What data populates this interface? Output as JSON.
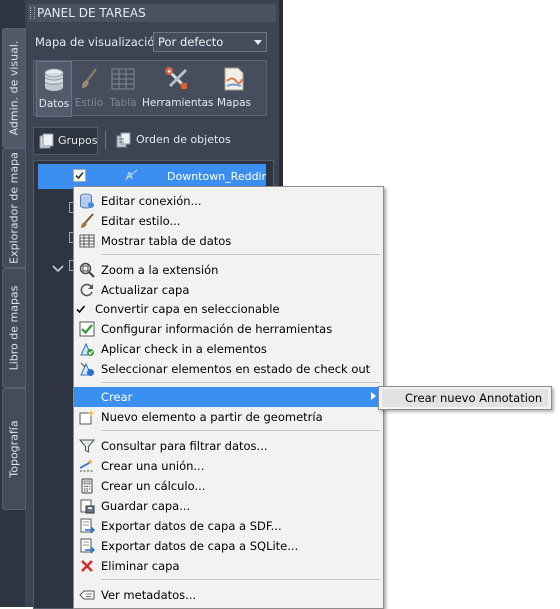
{
  "task_panel": {
    "title": "PANEL DE TAREAS",
    "vertical_tabs": [
      {
        "label": "Admin. de visual.",
        "active": true
      },
      {
        "label": "Explorador de mapa",
        "active": false
      },
      {
        "label": "Libro de mapas",
        "active": false
      },
      {
        "label": "Topografía",
        "active": false
      }
    ],
    "map_view_label": "Mapa de visualización:",
    "map_view_value": "Por defecto",
    "toolbar": [
      {
        "label": "Datos",
        "icon": "database-icon",
        "enabled": true
      },
      {
        "label": "Estilo",
        "icon": "brush-icon",
        "enabled": false
      },
      {
        "label": "Tabla",
        "icon": "table-icon",
        "enabled": false
      },
      {
        "label": "Herramientas",
        "icon": "tools-icon",
        "enabled": true
      },
      {
        "label": "Mapas",
        "icon": "map-icon",
        "enabled": true
      }
    ],
    "view_tabs": {
      "groups": "Grupos",
      "draw_order": "Orden de objetos"
    },
    "selected_layer": "Downtown_Reddir"
  },
  "context_menu": {
    "items": [
      {
        "label": "Editar conexión...",
        "icon": "connection-icon"
      },
      {
        "label": "Editar estilo...",
        "icon": "brush-icon"
      },
      {
        "label": "Mostrar tabla de datos",
        "icon": "table-icon"
      },
      {
        "label": "Zoom a la extensión",
        "icon": "zoom-icon"
      },
      {
        "label": "Actualizar capa",
        "icon": "refresh-icon"
      },
      {
        "label": "Convertir capa en seleccionable",
        "icon": "checkmark-icon"
      },
      {
        "label": "Configurar información de herramientas",
        "icon": "tooltip-config-icon"
      },
      {
        "label": "Aplicar check in a elementos",
        "icon": "checkin-icon"
      },
      {
        "label": "Seleccionar elementos en estado de check out",
        "icon": "checkout-select-icon"
      },
      {
        "label": "Crear",
        "icon": "",
        "highlighted": true
      },
      {
        "label": "Nuevo elemento a partir de geometría",
        "icon": "new-feature-icon"
      },
      {
        "label": "Consultar para filtrar datos...",
        "icon": "filter-icon"
      },
      {
        "label": "Crear una unión...",
        "icon": "join-icon"
      },
      {
        "label": "Crear un cálculo...",
        "icon": "calculator-icon"
      },
      {
        "label": "Guardar capa...",
        "icon": "save-layer-icon"
      },
      {
        "label": "Exportar datos de capa a SDF...",
        "icon": "export-sdf-icon"
      },
      {
        "label": "Exportar datos de capa a SQLite...",
        "icon": "export-sqlite-icon"
      },
      {
        "label": "Eliminar capa",
        "icon": "delete-icon"
      },
      {
        "label": "Ver metadatos...",
        "icon": "metadata-icon"
      }
    ],
    "submenu": {
      "label": "Crear nuevo Annotation"
    }
  },
  "colors": {
    "highlight": "#3b8ff0",
    "panel": "#3b4453",
    "menu_bg": "#f2f2f2"
  }
}
